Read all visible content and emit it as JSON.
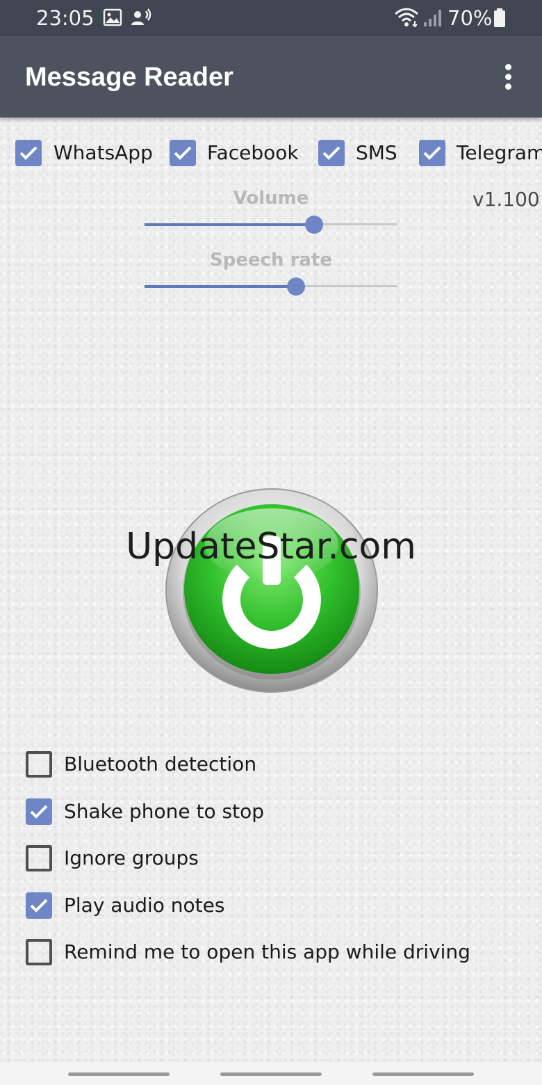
{
  "status_bar": {
    "time": "23:05",
    "battery": "70%",
    "icons": [
      "image-icon",
      "voice-icon",
      "wifi-icon",
      "signal-icon",
      "battery-icon"
    ]
  },
  "app_bar": {
    "title": "Message Reader",
    "menu_icon": "more-vert-icon"
  },
  "apps": [
    {
      "label": "WhatsApp",
      "checked": true
    },
    {
      "label": "Facebook",
      "checked": true
    },
    {
      "label": "SMS",
      "checked": true
    },
    {
      "label": "Telegram",
      "checked": true
    }
  ],
  "version": "v1.100",
  "volume": {
    "label": "Volume",
    "value": 0.67
  },
  "speech_rate": {
    "label": "Speech rate",
    "value": 0.6
  },
  "power_button": {
    "state": "on",
    "icon": "power-icon",
    "color": "#2fbf2f"
  },
  "watermark": "UpdateStar.com",
  "options": [
    {
      "label": "Bluetooth detection",
      "checked": false
    },
    {
      "label": "Shake phone to stop",
      "checked": true
    },
    {
      "label": "Ignore groups",
      "checked": false
    },
    {
      "label": "Play audio notes",
      "checked": true
    },
    {
      "label": "Remind me to open this app while driving",
      "checked": false
    }
  ],
  "colors": {
    "accent": "#6f86c6",
    "app_bar": "#4d535e",
    "status_bar": "#3f4551"
  }
}
